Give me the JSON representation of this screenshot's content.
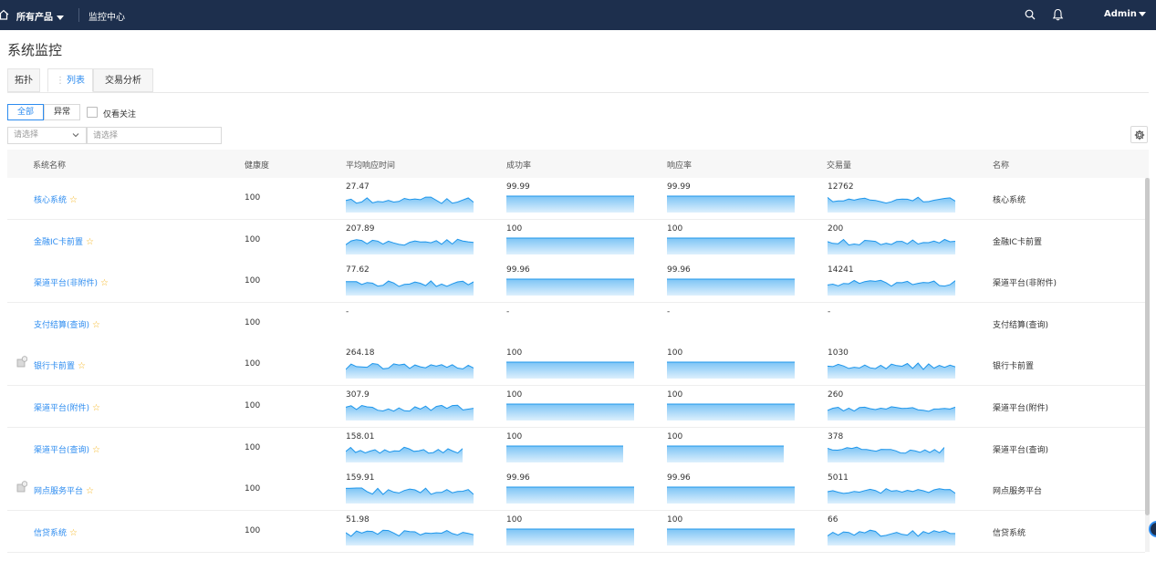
{
  "topbar": {
    "product_menu": "所有产品",
    "module_title": "监控中心",
    "user": "Admin"
  },
  "page": {
    "title": "系统监控"
  },
  "tabs": [
    {
      "label": "拓扑",
      "active": false
    },
    {
      "label": "列表",
      "active": true
    },
    {
      "label": "交易分析",
      "active": false
    }
  ],
  "filters": {
    "all_label": "全部",
    "abnormal_label": "异常",
    "follow_only_label": "仅看关注",
    "select_placeholder": "请选择",
    "input_placeholder": "请选择"
  },
  "table": {
    "columns": [
      "系统名称",
      "健康度",
      "平均响应时间",
      "成功率",
      "响应率",
      "交易量",
      "名称"
    ],
    "rows": [
      {
        "system": "核心系统",
        "health": "100",
        "avg_resp": "27.47",
        "success": "99.99",
        "response": "99.99",
        "volume": "12762",
        "name": "核心系统",
        "has_icon": false
      },
      {
        "system": "金融IC卡前置",
        "health": "100",
        "avg_resp": "207.89",
        "success": "100",
        "response": "100",
        "volume": "200",
        "name": "金融IC卡前置",
        "has_icon": false
      },
      {
        "system": "渠道平台(非附件)",
        "health": "100",
        "avg_resp": "77.62",
        "success": "99.96",
        "response": "99.96",
        "volume": "14241",
        "name": "渠道平台(非附件)",
        "has_icon": false
      },
      {
        "system": "支付结算(查询)",
        "health": "100",
        "avg_resp": "-",
        "success": "-",
        "response": "-",
        "volume": "-",
        "name": "支付结算(查询)",
        "has_icon": false
      },
      {
        "system": "银行卡前置",
        "health": "100",
        "avg_resp": "264.18",
        "success": "100",
        "response": "100",
        "volume": "1030",
        "name": "银行卡前置",
        "has_icon": true
      },
      {
        "system": "渠道平台(附件)",
        "health": "100",
        "avg_resp": "307.9",
        "success": "100",
        "response": "100",
        "volume": "260",
        "name": "渠道平台(附件)",
        "has_icon": false
      },
      {
        "system": "渠道平台(查询)",
        "health": "100",
        "avg_resp": "158.01",
        "success": "100",
        "response": "100",
        "volume": "378",
        "name": "渠道平台(查询)",
        "has_icon": false
      },
      {
        "system": "网点服务平台",
        "health": "100",
        "avg_resp": "159.91",
        "success": "99.96",
        "response": "99.96",
        "volume": "5011",
        "name": "网点服务平台",
        "has_icon": true
      },
      {
        "system": "信贷系统",
        "health": "100",
        "avg_resp": "51.98",
        "success": "100",
        "response": "100",
        "volume": "66",
        "name": "信贷系统",
        "has_icon": false
      }
    ]
  },
  "colors": {
    "topbar_bg": "#1d2f4d",
    "accent": "#2d8cf0",
    "sparkline_fill": "#7cc4f5",
    "sparkline_line": "#1e96eb",
    "star": "#f5b51f"
  },
  "icons": [
    "home-icon",
    "search-icon",
    "bell-icon",
    "gear-icon",
    "chevron-down-icon",
    "star-icon",
    "instance-icon"
  ]
}
